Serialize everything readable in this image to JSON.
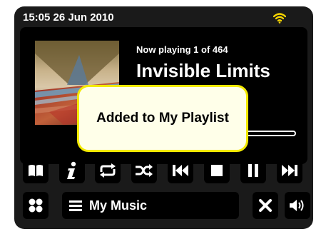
{
  "status": {
    "time": "15:05 26 Jun 2010",
    "wifi_icon": "wifi-icon",
    "wifi_color": "#f5d400"
  },
  "player": {
    "now_playing": "Now playing 1 of 464",
    "track_title": "Invisible Limits",
    "album_art_icon": "album-art"
  },
  "popup": {
    "message": "Added to My Playlist"
  },
  "controls": {
    "items": [
      "bookmarks-icon",
      "info-icon",
      "repeat-icon",
      "shuffle-icon",
      "previous-track-icon",
      "stop-icon",
      "pause-icon",
      "next-track-icon"
    ]
  },
  "bottom_bar": {
    "home_icon": "home-grid-icon",
    "menu_label": "My Music",
    "menu_icon": "menu-list-icon",
    "close_icon": "close-icon",
    "volume_icon": "volume-icon"
  },
  "colors": {
    "frame": "#1a1a1a",
    "panel": "#000000",
    "popup_bg": "#ffffe9",
    "popup_border": "#f3ea00"
  }
}
